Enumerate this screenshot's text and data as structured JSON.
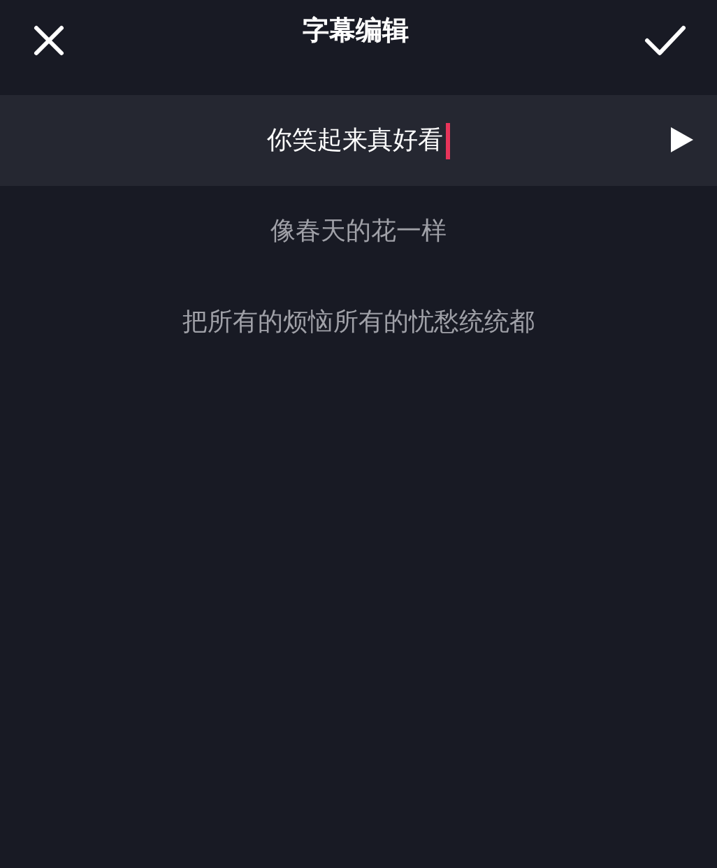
{
  "header": {
    "title": "字幕编辑"
  },
  "subtitles": [
    {
      "text": "你笑起来真好看",
      "selected": true
    },
    {
      "text": "像春天的花一样",
      "selected": false
    },
    {
      "text": "把所有的烦恼所有的忧愁统统都",
      "selected": false
    }
  ]
}
